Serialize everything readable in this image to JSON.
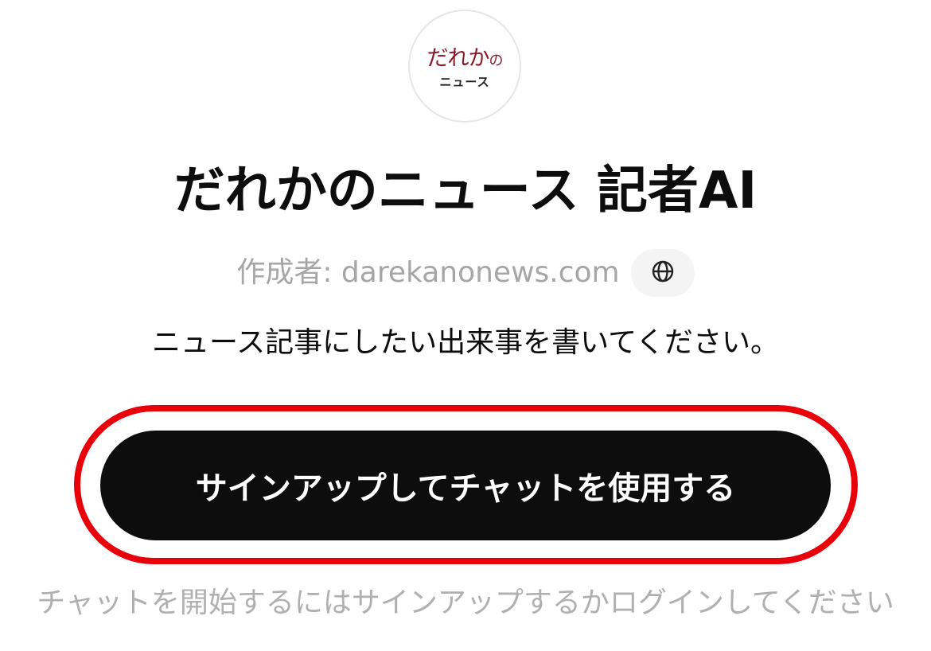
{
  "gpt": {
    "logo_text_main": "だれか",
    "logo_text_small": "の",
    "logo_text_sub": "ニュース",
    "title": "だれかのニュース 記者AI",
    "author": "作成者: darekanonews.com",
    "author_link_icon": "globe-icon",
    "description": "ニュース記事にしたい出来事を書いてください。"
  },
  "cta": {
    "label": "サインアップしてチャットを使用する",
    "highlight_color": "#e8000b"
  },
  "footer": {
    "notice": "チャットを開始するにはサインアップするかログインしてください"
  },
  "colors": {
    "logo_accent": "#8b1a2b",
    "button_bg": "#0d0d0d",
    "muted_text": "#a6a6a6"
  }
}
